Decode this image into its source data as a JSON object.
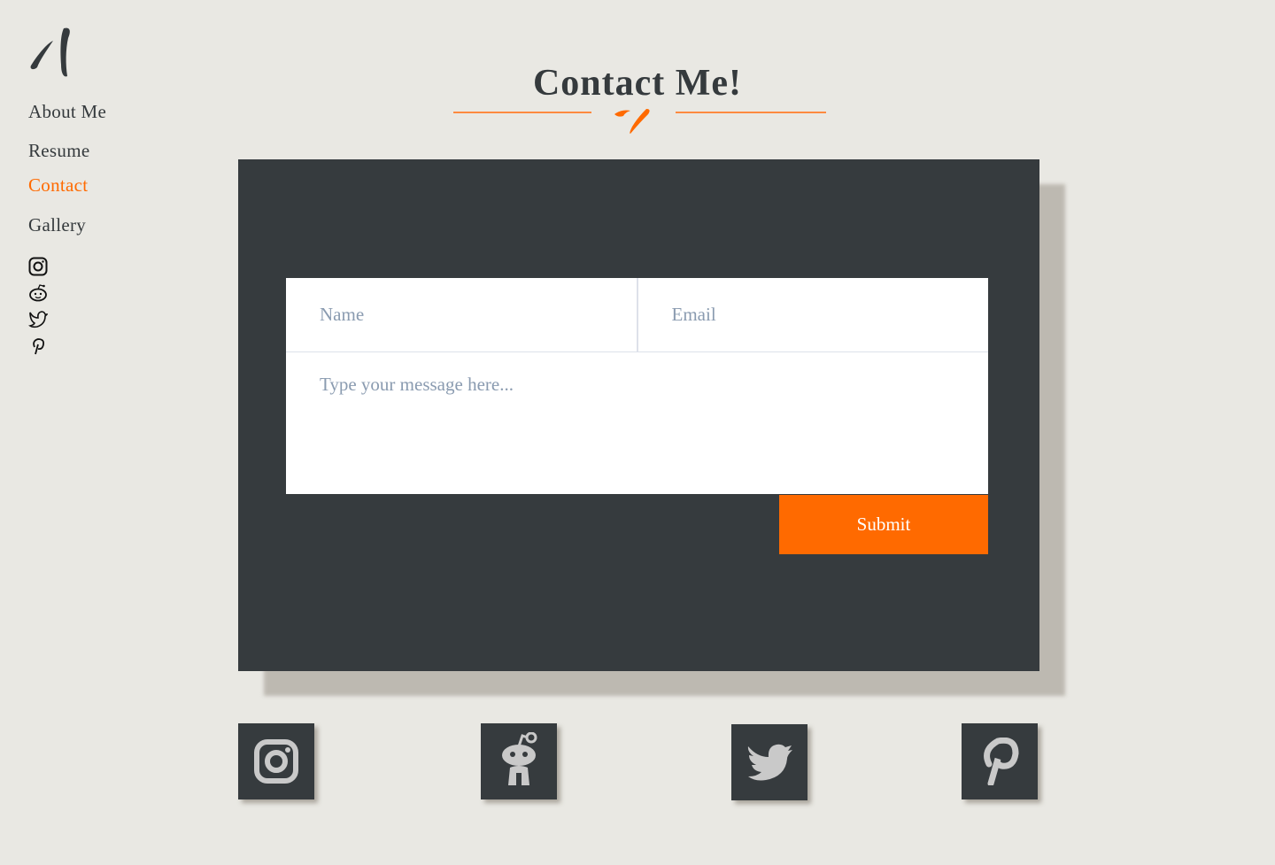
{
  "nav": {
    "items": [
      {
        "label": "About Me"
      },
      {
        "label": "Resume"
      },
      {
        "label": "Contact",
        "active": true
      },
      {
        "label": "Gallery"
      }
    ]
  },
  "side_icons": [
    "instagram-icon",
    "reddit-icon",
    "twitter-icon",
    "pinterest-icon"
  ],
  "title": "Contact Me!",
  "form": {
    "name_placeholder": "Name",
    "email_placeholder": "Email",
    "message_placeholder": "Type your message here...",
    "submit_label": "Submit"
  },
  "social_buttons": [
    "instagram",
    "reddit",
    "twitter",
    "pinterest"
  ],
  "colors": {
    "accent": "#ff6a00",
    "dark": "#363b3e",
    "background": "#e9e8e3"
  }
}
